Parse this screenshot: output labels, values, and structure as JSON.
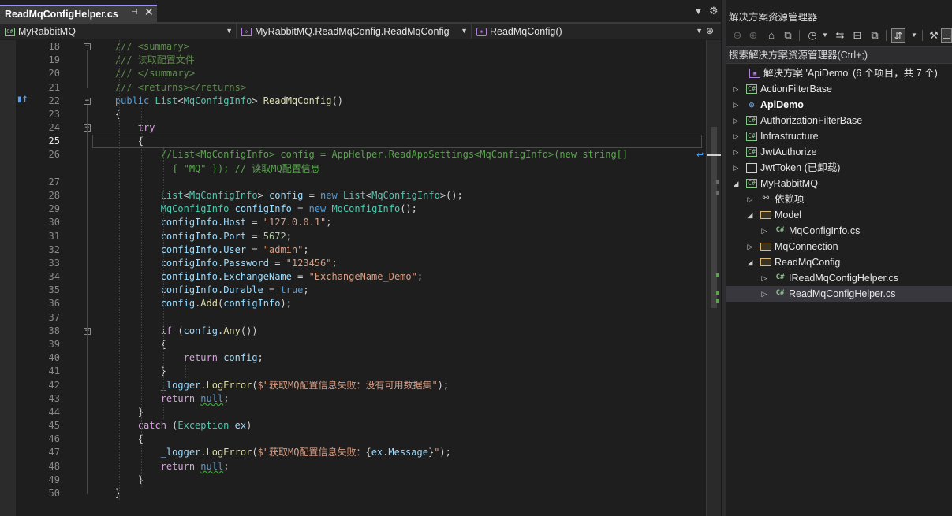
{
  "editor": {
    "tab": {
      "title": "ReadMqConfigHelper.cs",
      "pin_icon": "pin-icon",
      "close_glyph": "✕"
    },
    "nav": {
      "project": "MyRabbitMQ",
      "class_path": "MyRabbitMQ.ReadMqConfig.ReadMqConfig",
      "member": "ReadMqConfig()"
    },
    "lines": [
      {
        "n": "18",
        "html": "    <span class=\"dc\">/// &lt;summary&gt;</span>",
        "fold": "−"
      },
      {
        "n": "19",
        "html": "    <span class=\"dc\">/// 读取配置文件</span>"
      },
      {
        "n": "20",
        "html": "    <span class=\"dc\">/// &lt;/summary&gt;</span>"
      },
      {
        "n": "21",
        "html": "    <span class=\"dc\">/// &lt;returns&gt;&lt;/returns&gt;</span>"
      },
      {
        "n": "22",
        "html": "    <span class=\"kw\">public</span> <span class=\"ty\">List</span>&lt;<span class=\"ty\">MqConfigInfo</span>&gt; <span class=\"fn\">ReadMqConfig</span>()",
        "fold": "−",
        "glyph": "▮↑"
      },
      {
        "n": "23",
        "html": "    {"
      },
      {
        "n": "24",
        "html": "        <span class=\"ctrl\">try</span>",
        "fold": "−"
      },
      {
        "n": "25",
        "html": "        {",
        "current": true
      },
      {
        "n": "26",
        "html": "            <span class=\"cm\">//List&lt;MqConfigInfo&gt; config = AppHelper.ReadAppSettings&lt;MqConfigInfo&gt;(new string[]</span>",
        "wrap": true
      },
      {
        "n": "",
        "html": "              <span class=\"cm\">{ \"MQ\" }); // 读取MQ配置信息</span>"
      },
      {
        "n": "27",
        "html": ""
      },
      {
        "n": "28",
        "html": "            <span class=\"ty\">List</span>&lt;<span class=\"ty\">MqConfigInfo</span>&gt; <span class=\"var\">config</span> = <span class=\"kw\">new</span> <span class=\"ty\">List</span>&lt;<span class=\"ty\">MqConfigInfo</span>&gt;();"
      },
      {
        "n": "29",
        "html": "            <span class=\"ty\">MqConfigInfo</span> <span class=\"var\">configInfo</span> = <span class=\"kw\">new</span> <span class=\"ty\">MqConfigInfo</span>();"
      },
      {
        "n": "30",
        "html": "            <span class=\"var\">configInfo</span>.<span class=\"var\">Host</span> = <span class=\"str\">\"127.0.0.1\"</span>;"
      },
      {
        "n": "31",
        "html": "            <span class=\"var\">configInfo</span>.<span class=\"var\">Port</span> = <span class=\"num\">5672</span>;"
      },
      {
        "n": "32",
        "html": "            <span class=\"var\">configInfo</span>.<span class=\"var\">User</span> = <span class=\"str\">\"admin\"</span>;"
      },
      {
        "n": "33",
        "html": "            <span class=\"var\">configInfo</span>.<span class=\"var\">Password</span> = <span class=\"str\">\"123456\"</span>;"
      },
      {
        "n": "34",
        "html": "            <span class=\"var\">configInfo</span>.<span class=\"var\">ExchangeName</span> = <span class=\"str\">\"ExchangeName_Demo\"</span>;"
      },
      {
        "n": "35",
        "html": "            <span class=\"var\">configInfo</span>.<span class=\"var\">Durable</span> = <span class=\"kw\">true</span>;"
      },
      {
        "n": "36",
        "html": "            <span class=\"var\">config</span>.<span class=\"fn\">Add</span>(<span class=\"var\">configInfo</span>);"
      },
      {
        "n": "37",
        "html": ""
      },
      {
        "n": "38",
        "html": "            <span class=\"ctrl\">if</span> (<span class=\"var\">config</span>.<span class=\"fn\">Any</span>())",
        "fold": "−"
      },
      {
        "n": "39",
        "html": "            {"
      },
      {
        "n": "40",
        "html": "                <span class=\"ctrl\">return</span> <span class=\"var\">config</span>;"
      },
      {
        "n": "41",
        "html": "            }"
      },
      {
        "n": "42",
        "html": "            <span class=\"var\">_logger</span>.<span class=\"fn\">LogError</span>(<span class=\"str\">$\"获取MQ配置信息失败：没有可用数据集\"</span>);"
      },
      {
        "n": "43",
        "html": "            <span class=\"ctrl\">return</span> <span class=\"kw sq\">null</span>;"
      },
      {
        "n": "44",
        "html": "        }"
      },
      {
        "n": "45",
        "html": "        <span class=\"ctrl\">catch</span> (<span class=\"ty\">Exception</span> <span class=\"var\">ex</span>)"
      },
      {
        "n": "46",
        "html": "        {"
      },
      {
        "n": "47",
        "html": "            <span class=\"var\">_logger</span>.<span class=\"fn\">LogError</span>(<span class=\"str\">$\"获取MQ配置信息失败：</span>{<span class=\"var\">ex</span>.<span class=\"var\">Message</span>}<span class=\"str\">\"</span>);"
      },
      {
        "n": "48",
        "html": "            <span class=\"ctrl\">return</span> <span class=\"kw sq\">null</span>;"
      },
      {
        "n": "49",
        "html": "        }"
      },
      {
        "n": "50",
        "html": "    }"
      }
    ]
  },
  "explorer": {
    "title": "解决方案资源管理器",
    "search_placeholder": "搜索解决方案资源管理器(Ctrl+;)",
    "toolbar_icons": [
      "back-icon",
      "forward-icon",
      "home-icon",
      "vs-switch-icon",
      "history-icon",
      "sync-icon",
      "collapse-all-icon",
      "show-all-files-icon",
      "sync-with-editor-icon",
      "properties-icon",
      "preview-icon"
    ],
    "tree": [
      {
        "label": "解决方案 'ApiDemo' (6 个项目，共 7 个)",
        "icon": "sln",
        "icon_text": "▣",
        "indent": 0,
        "expander": ""
      },
      {
        "label": "ActionFilterBase",
        "icon": "proj",
        "icon_text": "C#",
        "indent": 1,
        "expander": "▷"
      },
      {
        "label": "ApiDemo",
        "icon": "web",
        "icon_text": "⊕",
        "indent": 1,
        "expander": "▷",
        "bold": true
      },
      {
        "label": "AuthorizationFilterBase",
        "icon": "proj",
        "icon_text": "C#",
        "indent": 1,
        "expander": "▷"
      },
      {
        "label": "Infrastructure",
        "icon": "proj",
        "icon_text": "C#",
        "indent": 1,
        "expander": "▷"
      },
      {
        "label": "JwtAuthorize",
        "icon": "proj",
        "icon_text": "C#",
        "indent": 1,
        "expander": "▷"
      },
      {
        "label": "JwtToken (已卸载)",
        "icon": "unl",
        "icon_text": "",
        "indent": 1,
        "expander": "▷"
      },
      {
        "label": "MyRabbitMQ",
        "icon": "proj",
        "icon_text": "C#",
        "indent": 1,
        "expander": "◢"
      },
      {
        "label": "依赖项",
        "icon": "dep",
        "icon_text": "⚯",
        "indent": 2,
        "expander": "▷"
      },
      {
        "label": "Model",
        "icon": "folder",
        "icon_text": "",
        "indent": 2,
        "expander": "◢"
      },
      {
        "label": "MqConfigInfo.cs",
        "icon": "cs",
        "icon_text": "C#",
        "indent": 3,
        "expander": "▷"
      },
      {
        "label": "MqConnection",
        "icon": "folder",
        "icon_text": "",
        "indent": 2,
        "expander": "▷"
      },
      {
        "label": "ReadMqConfig",
        "icon": "folder",
        "icon_text": "",
        "indent": 2,
        "expander": "◢"
      },
      {
        "label": "IReadMqConfigHelper.cs",
        "icon": "cs",
        "icon_text": "C#",
        "indent": 3,
        "expander": "▷"
      },
      {
        "label": "ReadMqConfigHelper.cs",
        "icon": "cs",
        "icon_text": "C#",
        "indent": 3,
        "expander": "▷",
        "selected": true
      }
    ]
  }
}
